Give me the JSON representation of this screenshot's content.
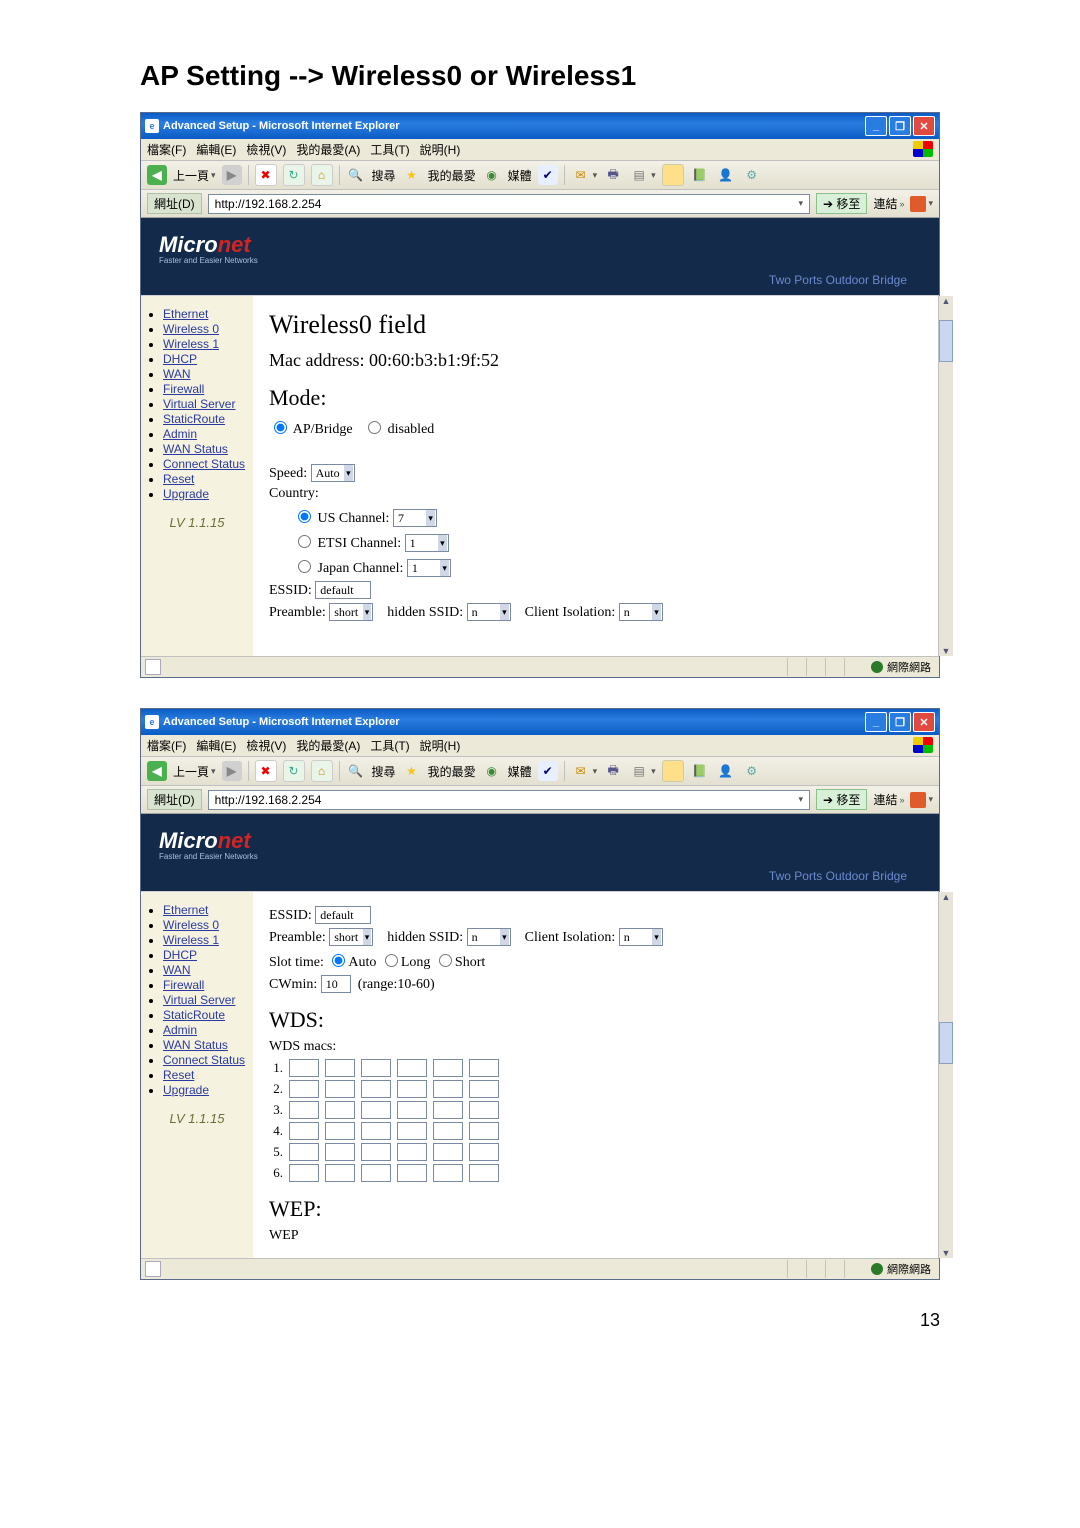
{
  "doc_title": "AP Setting --> Wireless0 or Wireless1",
  "page_number": "13",
  "ie": {
    "title": "Advanced Setup - Microsoft Internet Explorer",
    "menu": {
      "file": "檔案(F)",
      "edit": "編輯(E)",
      "view": "檢視(V)",
      "fav": "我的最愛(A)",
      "tools": "工具(T)",
      "help": "說明(H)"
    },
    "toolbar": {
      "back": "上一頁",
      "search": "搜尋",
      "favorites": "我的最愛",
      "media": "媒體"
    },
    "addr_label": "網址(D)",
    "url": "http://192.168.2.254",
    "go": "移至",
    "links": "連結",
    "banner": {
      "logo1": "Micro",
      "logo2": "net",
      "tagline": "Faster and Easier Networks",
      "right": "Two Ports Outdoor Bridge"
    },
    "status_zone": "網際網路"
  },
  "sidebar": {
    "items": [
      "Ethernet",
      "Wireless 0",
      "Wireless 1",
      "DHCP",
      "WAN",
      "Firewall",
      "Virtual Server",
      "StaticRoute",
      "Admin",
      "WAN Status",
      "Connect Status",
      "Reset",
      "Upgrade"
    ],
    "version": "LV 1.1.15"
  },
  "win1": {
    "heading": "Wireless0 field",
    "mac_label": "Mac address: 00:60:b3:b1:9f:52",
    "mode_label": "Mode:",
    "mode_opt1": "AP/Bridge",
    "mode_opt2": "disabled",
    "speed_label": "Speed:",
    "speed_val": "Auto",
    "country_label": "Country:",
    "us": "US Channel:",
    "us_val": "7",
    "etsi": "ETSI Channel:",
    "etsi_val": "1",
    "japan": "Japan Channel:",
    "japan_val": "1",
    "essid_label": "ESSID:",
    "essid_val": "default",
    "preamble_label": "Preamble:",
    "preamble_val": "short",
    "hidden_label": "hidden SSID:",
    "hidden_val": "n",
    "iso_label": "Client Isolation:",
    "iso_val": "n"
  },
  "win2": {
    "essid_label": "ESSID:",
    "essid_val": "default",
    "preamble_label": "Preamble:",
    "preamble_val": "short",
    "hidden_label": "hidden SSID:",
    "hidden_val": "n",
    "iso_label": "Client Isolation:",
    "iso_val": "n",
    "slot_label": "Slot time:",
    "slot_auto": "Auto",
    "slot_long": "Long",
    "slot_short": "Short",
    "cwmin_label": "CWmin:",
    "cwmin_val": "10",
    "cwmin_range": "(range:10-60)",
    "wds_heading": "WDS:",
    "wds_macs": "WDS macs:",
    "rows": [
      "1.",
      "2.",
      "3.",
      "4.",
      "5.",
      "6."
    ],
    "wep_heading": "WEP:",
    "wep": "WEP"
  }
}
